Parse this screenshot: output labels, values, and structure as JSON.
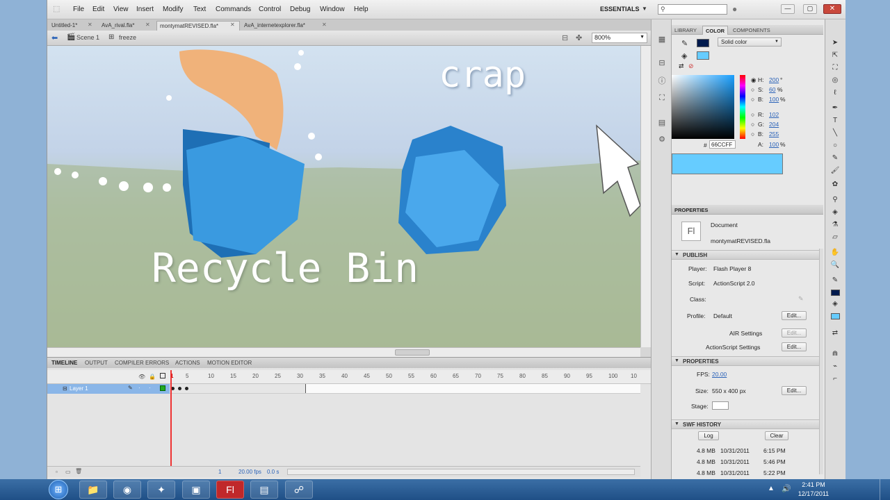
{
  "menu": {
    "items": [
      "File",
      "Edit",
      "View",
      "Insert",
      "Modify",
      "Text",
      "Commands",
      "Control",
      "Debug",
      "Window",
      "Help"
    ],
    "workspace": "ESSENTIALS",
    "search_placeholder": ""
  },
  "doc_tabs": [
    {
      "label": "Untitled-1*"
    },
    {
      "label": "AvA_rival.fla*"
    },
    {
      "label": "montymatREVISED.fla*"
    },
    {
      "label": "AvA_internetexplorer.fla*"
    }
  ],
  "editbar": {
    "scene": "Scene 1",
    "symbol": "freeze",
    "zoom": "800%"
  },
  "stage": {
    "title_text": "crap",
    "label_text": "Recycle Bin"
  },
  "timeline": {
    "tabs": [
      "TIMELINE",
      "OUTPUT",
      "COMPILER ERRORS",
      "ACTIONS",
      "MOTION EDITOR"
    ],
    "frame_numbers": [
      "5",
      "10",
      "15",
      "20",
      "25",
      "30",
      "35",
      "40",
      "45",
      "50",
      "55",
      "60",
      "65",
      "70",
      "75",
      "80",
      "85",
      "90",
      "95",
      "100",
      "10"
    ],
    "current_frame_marker": "1",
    "layer_name": "Layer 1",
    "status_frame": "1",
    "status_fps": "20.00 fps",
    "status_time": "0.0 s"
  },
  "color_panel": {
    "tabs": [
      "LIBRARY",
      "COLOR",
      "COMPONENTS"
    ],
    "type": "Solid color",
    "H": {
      "label": "H:",
      "value": "200",
      "unit": "°"
    },
    "S": {
      "label": "S:",
      "value": "60",
      "unit": "%"
    },
    "B": {
      "label": "B:",
      "value": "100",
      "unit": "%"
    },
    "R": {
      "label": "R:",
      "value": "102"
    },
    "G": {
      "label": "G:",
      "value": "204"
    },
    "Bl": {
      "label": "B:",
      "value": "255"
    },
    "A": {
      "label": "A:",
      "value": "100",
      "unit": "%"
    },
    "hex": "66CCFF",
    "hex_prefix": "#",
    "swatch": "#66ccff"
  },
  "properties": {
    "title": "PROPERTIES",
    "doc_type": "Document",
    "doc_name": "montymatREVISED.fla",
    "doc_icon": "Fl",
    "publish": {
      "header": "PUBLISH",
      "player_label": "Player:",
      "player": "Flash Player 8",
      "script_label": "Script:",
      "script": "ActionScript 2.0",
      "class_label": "Class:",
      "profile_label": "Profile:",
      "profile": "Default",
      "air": "AIR Settings",
      "as": "ActionScript Settings",
      "edit": "Edit..."
    },
    "props": {
      "header": "PROPERTIES",
      "fps_label": "FPS:",
      "fps": "20.00",
      "size_label": "Size:",
      "size": "550 x 400 px",
      "stage_label": "Stage:",
      "edit": "Edit..."
    },
    "swf": {
      "header": "SWF HISTORY",
      "log": "Log",
      "clear": "Clear",
      "entries": [
        {
          "size": "4.8 MB",
          "date": "10/31/2011",
          "time": "6:15 PM"
        },
        {
          "size": "4.8 MB",
          "date": "10/31/2011",
          "time": "5:46 PM"
        },
        {
          "size": "4.8 MB",
          "date": "10/31/2011",
          "time": "5:22 PM"
        }
      ]
    }
  },
  "taskbar": {
    "time": "2:41 PM",
    "date": "12/17/2011"
  }
}
